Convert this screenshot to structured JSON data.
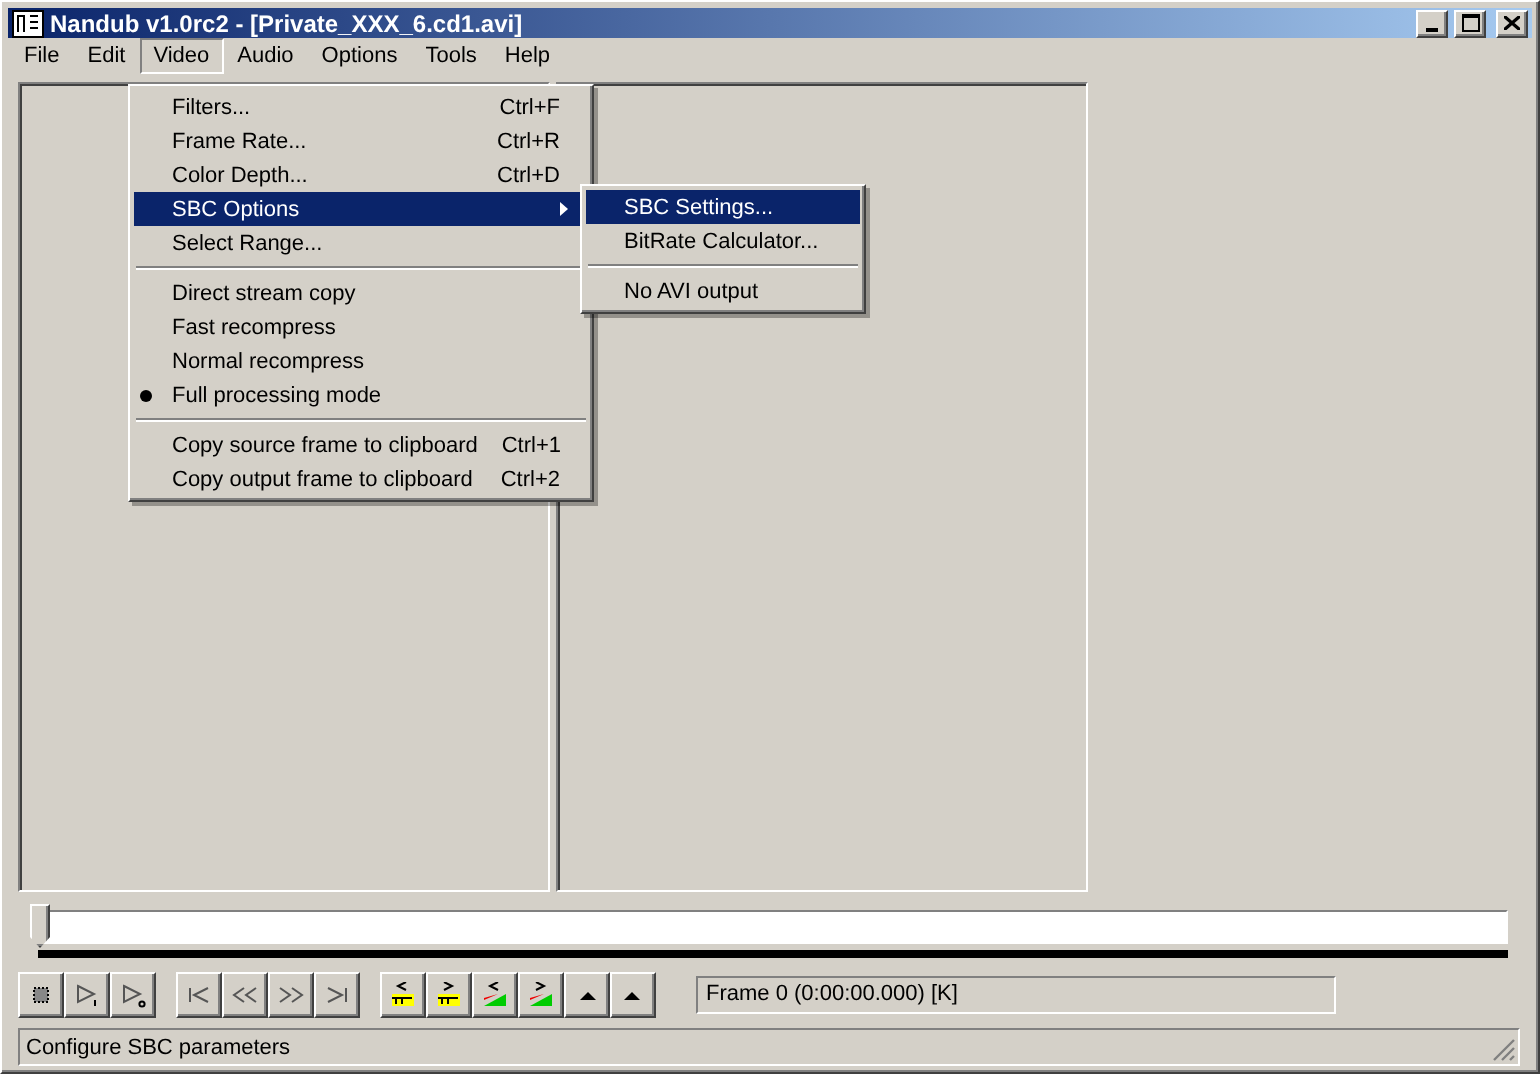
{
  "window": {
    "title": "Nandub v1.0rc2 - [Private_XXX_6.cd1.avi]"
  },
  "menu_bar": [
    {
      "label": "File",
      "selected": false
    },
    {
      "label": "Edit",
      "selected": false
    },
    {
      "label": "Video",
      "selected": true
    },
    {
      "label": "Audio",
      "selected": false
    },
    {
      "label": "Options",
      "selected": false
    },
    {
      "label": "Tools",
      "selected": false
    },
    {
      "label": "Help",
      "selected": false
    }
  ],
  "video_menu": [
    {
      "kind": "item",
      "label": "Filters...",
      "shortcut": "Ctrl+F",
      "selected": false,
      "checked": false,
      "submenu": false
    },
    {
      "kind": "item",
      "label": "Frame Rate...",
      "shortcut": "Ctrl+R",
      "selected": false,
      "checked": false,
      "submenu": false
    },
    {
      "kind": "item",
      "label": "Color Depth...",
      "shortcut": "Ctrl+D",
      "selected": false,
      "checked": false,
      "submenu": false
    },
    {
      "kind": "item",
      "label": "SBC Options",
      "selected": true,
      "checked": false,
      "submenu": true
    },
    {
      "kind": "item",
      "label": "Select Range...",
      "selected": false,
      "checked": false,
      "submenu": false
    },
    {
      "kind": "separator"
    },
    {
      "kind": "item",
      "label": "Direct stream copy",
      "selected": false,
      "checked": false,
      "submenu": false
    },
    {
      "kind": "item",
      "label": "Fast recompress",
      "selected": false,
      "checked": false,
      "submenu": false
    },
    {
      "kind": "item",
      "label": "Normal recompress",
      "selected": false,
      "checked": false,
      "submenu": false
    },
    {
      "kind": "item",
      "label": "Full processing mode",
      "selected": false,
      "checked": true,
      "submenu": false
    },
    {
      "kind": "separator"
    },
    {
      "kind": "item",
      "label": "Copy source frame to clipboard",
      "shortcut": "Ctrl+1",
      "selected": false,
      "checked": false,
      "submenu": false
    },
    {
      "kind": "item",
      "label": "Copy output frame to clipboard",
      "shortcut": "Ctrl+2",
      "selected": false,
      "checked": false,
      "submenu": false
    }
  ],
  "sbc_submenu": [
    {
      "kind": "item",
      "label": "SBC Settings...",
      "selected": true,
      "checked": false,
      "submenu": false
    },
    {
      "kind": "item",
      "label": "BitRate Calculator...",
      "selected": false,
      "checked": false,
      "submenu": false
    },
    {
      "kind": "separator"
    },
    {
      "kind": "item",
      "label": "No AVI output",
      "selected": false,
      "checked": false,
      "submenu": false
    }
  ],
  "position_slider": {
    "level": 0
  },
  "frame_field": {
    "value": "Frame 0 (0:00:00.000) [K]"
  },
  "status_bar": {
    "text": "Configure SBC parameters"
  }
}
